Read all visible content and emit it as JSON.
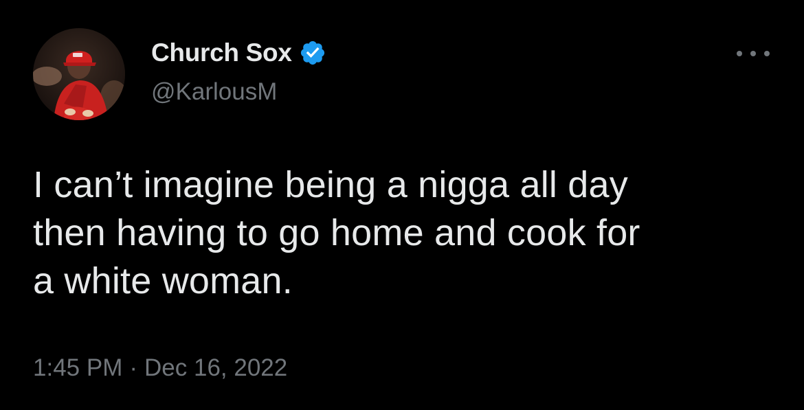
{
  "tweet": {
    "author": {
      "display_name": "Church Sox",
      "handle": "@KarlousM",
      "verified": true,
      "avatar_icon": "profile-photo"
    },
    "more_icon": "ellipsis-icon",
    "text_lines": [
      "I can’t imagine being a nigga all day",
      "then having to go home and cook for",
      "a white woman."
    ],
    "time": "1:45 PM",
    "separator": "·",
    "date": "Dec 16, 2022"
  },
  "colors": {
    "background": "#000000",
    "primary_text": "#e7e9ea",
    "secondary_text": "#71767b",
    "verified_badge": "#1d9bf0"
  }
}
